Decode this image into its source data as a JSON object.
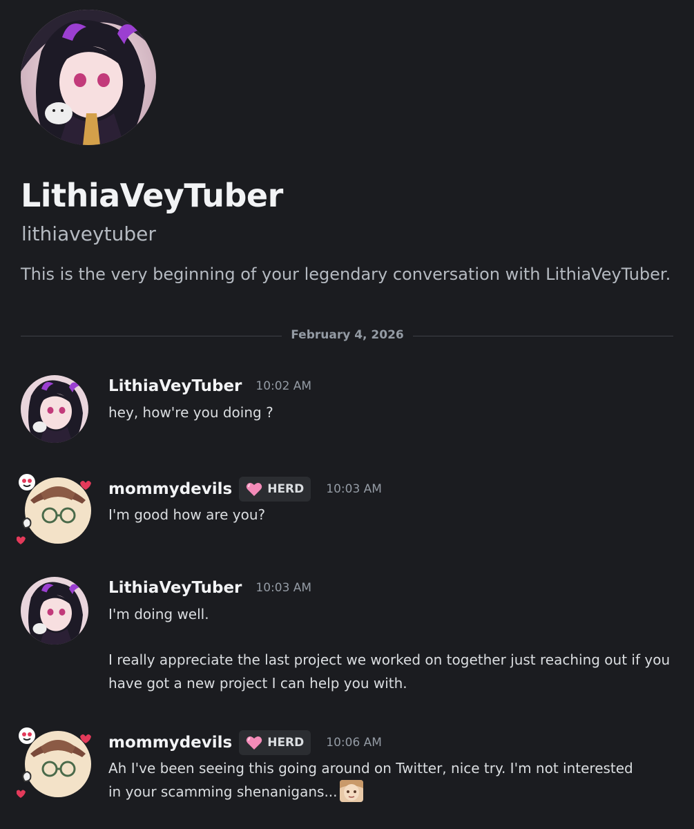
{
  "intro": {
    "display_name": "LithiaVeyTuber",
    "handle": "lithiaveytuber",
    "text": "This is the very beginning of your legendary conversation with LithiaVeyTuber."
  },
  "divider": {
    "date": "February 4, 2026"
  },
  "messages": [
    {
      "author": "LithiaVeyTuber",
      "time": "10:02 AM",
      "lines": [
        "hey, how're you doing ?"
      ]
    },
    {
      "author": "mommydevils",
      "badge": "HERD",
      "time": "10:03 AM",
      "lines": [
        "I'm good how are you?"
      ]
    },
    {
      "author": "LithiaVeyTuber",
      "time": "10:03 AM",
      "lines": [
        "I'm doing well.",
        "I really appreciate the last project we worked on together just reaching out if you have got a new project I can help you with."
      ]
    },
    {
      "author": "mommydevils",
      "badge": "HERD",
      "time": "10:06 AM",
      "lines": [
        "Ah I've been seeing this going around on Twitter, nice try. I'm not interested in your scamming shenanigans..."
      ]
    }
  ],
  "colors": {
    "background": "#1b1c20",
    "text_primary": "#f2f3f5",
    "text_muted": "#949ba4",
    "badge_bg": "#2b2d31",
    "badge_heart": "#f38bb8"
  },
  "icons": {
    "badge": "pink-heart-icon",
    "emoji": "custom-emoji",
    "avatar_decoration": "hearts-decoration"
  }
}
